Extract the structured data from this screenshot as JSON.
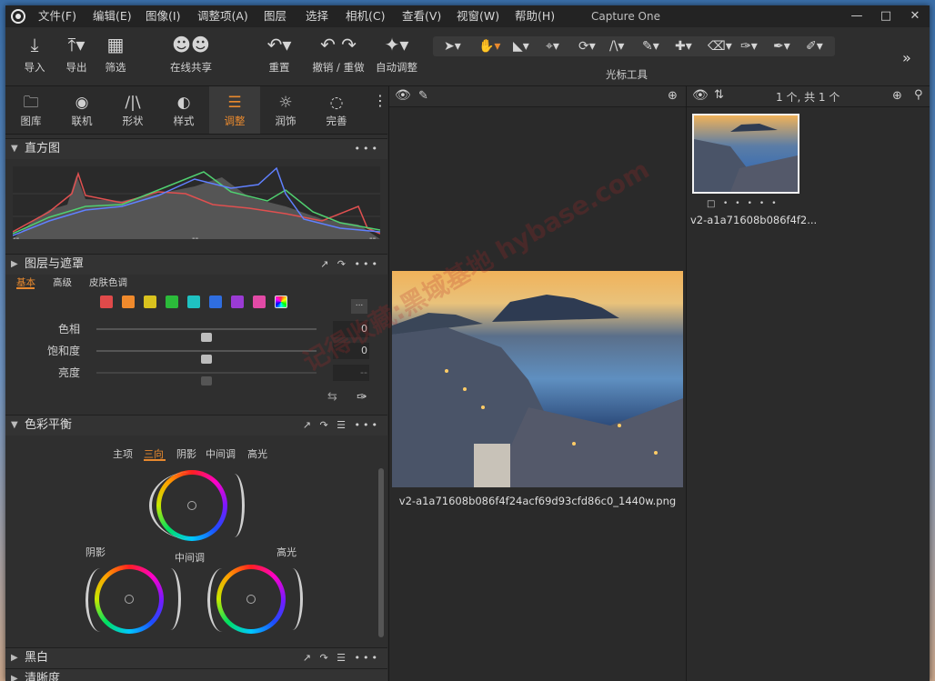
{
  "window": {
    "app_title": "Capture One"
  },
  "menu": [
    "文件(F)",
    "编辑(E)",
    "图像(I)",
    "调整项(A)",
    "图层",
    "选择",
    "相机(C)",
    "查看(V)",
    "视窗(W)",
    "帮助(H)"
  ],
  "toolbar": {
    "import": "导入",
    "export": "导出",
    "filter": "筛选",
    "share": "在线共享",
    "reset": "重置",
    "undo_redo": "撤销 / 重做",
    "auto_adjust": "自动调整",
    "cursor_tools": "光标工具"
  },
  "tabs": [
    "图库",
    "联机",
    "形状",
    "样式",
    "调整",
    "润饰",
    "完善"
  ],
  "sections": {
    "histogram": "直方图",
    "histogram_ticks": [
      "--",
      "--",
      "--"
    ],
    "layers": "图层与遮罩",
    "color_balance": "色彩平衡",
    "bw": "黑白",
    "clarity": "清晰度"
  },
  "color_editor": {
    "subtabs": [
      "基本",
      "高级",
      "皮肤色调"
    ],
    "more_label": "...",
    "rows": [
      {
        "label": "色相",
        "value": "0",
        "level": 0.5
      },
      {
        "label": "饱和度",
        "value": "0",
        "level": 0.5
      },
      {
        "label": "亮度",
        "value": "--",
        "level": 0.5
      }
    ],
    "swatch_colors": [
      "#e04a4a",
      "#f08a2c",
      "#d9c21e",
      "#2bbb3a",
      "#1fc2c2",
      "#2f6ee0",
      "#9b3bd4",
      "#e24aa6"
    ]
  },
  "color_balance": {
    "subtabs": [
      "主项",
      "三向",
      "阴影",
      "中间调",
      "高光"
    ],
    "active_subtab": "三向",
    "shadow_label": "阴影",
    "midtone_label": "中间调",
    "highlight_label": "高光"
  },
  "viewer": {
    "filename": "v2-a1a71608b086f4f24acf69d93cfd86c0_1440w.png"
  },
  "browser": {
    "count": "1 个, 共 1 个",
    "thumb_name": "v2-a1a71608b086f4f2..."
  },
  "watermark": "记得收藏:黑域基地 hybase.com",
  "colors": {
    "accent": "#e8892e",
    "panel": "#2f2f2f"
  }
}
